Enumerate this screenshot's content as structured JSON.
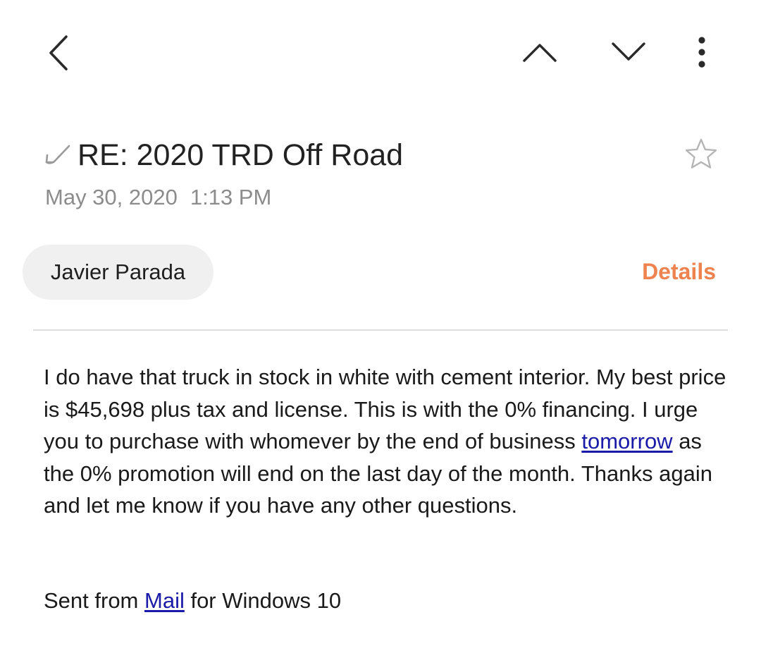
{
  "toolbar": {
    "back_icon": "chevron-left-icon",
    "previous_icon": "chevron-up-icon",
    "next_icon": "chevron-down-icon",
    "more_icon": "more-vertical-icon"
  },
  "email": {
    "reply_icon": "reply-arrow-icon",
    "subject": "RE: 2020 TRD Off Road",
    "star_icon": "star-outline-icon",
    "date": "May 30, 2020",
    "time": "1:13 PM",
    "sender": "Javier Parada",
    "details_label": "Details",
    "body": {
      "part1": "I do have that truck in stock in white with cement interior. My best price is $45,698 plus tax and license. This is with the 0% financing. I urge you to purchase with whomever by the end of business ",
      "link_tomorrow": "tomorrow",
      "part2": " as the 0% promotion will end on the last day of the month. Thanks again and let me know if you have any other questions."
    },
    "signature": {
      "prefix": "Sent from ",
      "link_mail": "Mail",
      "suffix": " for Windows 10"
    }
  },
  "colors": {
    "accent": "#ef8350",
    "link": "#1a1aa8",
    "secondary_text": "#8c8c8c",
    "chip_background": "#f0f0f0",
    "divider": "#dedede"
  }
}
